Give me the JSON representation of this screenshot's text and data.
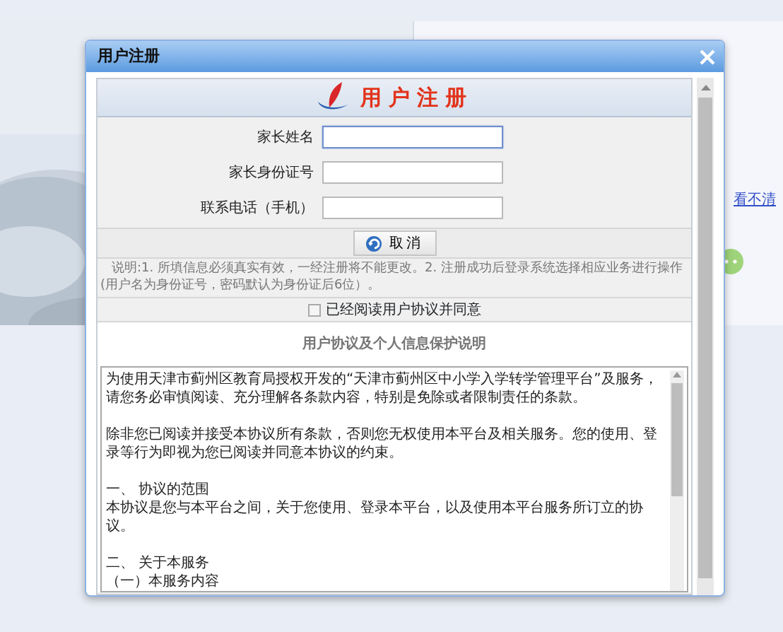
{
  "background": {
    "captcha_link": "看不清"
  },
  "dialog": {
    "title": "用户注册",
    "header_title": "用户注册",
    "fields": [
      {
        "label": "家长姓名",
        "focused": true
      },
      {
        "label": "家长身份证号",
        "focused": false
      },
      {
        "label": "联系电话（手机）",
        "focused": false
      }
    ],
    "cancel_button": "取消",
    "note": "说明:1. 所填信息必须真实有效，一经注册将不能更改。2. 注册成功后登录系统选择相应业务进行操作(用户名为身份证号，密码默认为身份证后6位）。",
    "agree": {
      "label": "已经阅读用户协议并同意",
      "checked": false
    },
    "agreement_title": "用户协议及个人信息保护说明",
    "agreement_paragraphs": [
      "为使用天津市蓟州区教育局授权开发的“天津市蓟州区中小学入学转学管理平台”及服务，请您务必审慎阅读、充分理解各条款内容，特别是免除或者限制责任的条款。",
      "除非您已阅读并接受本协议所有条款，否则您无权使用本平台及相关服务。您的使用、登录等行为即视为您已阅读并同意本协议的约束。",
      "一、 协议的范围",
      "本协议是您与本平台之间，关于您使用、登录本平台，以及使用本平台服务所订立的协议。",
      "二、 关于本服务",
      "（一）本服务内容"
    ]
  }
}
